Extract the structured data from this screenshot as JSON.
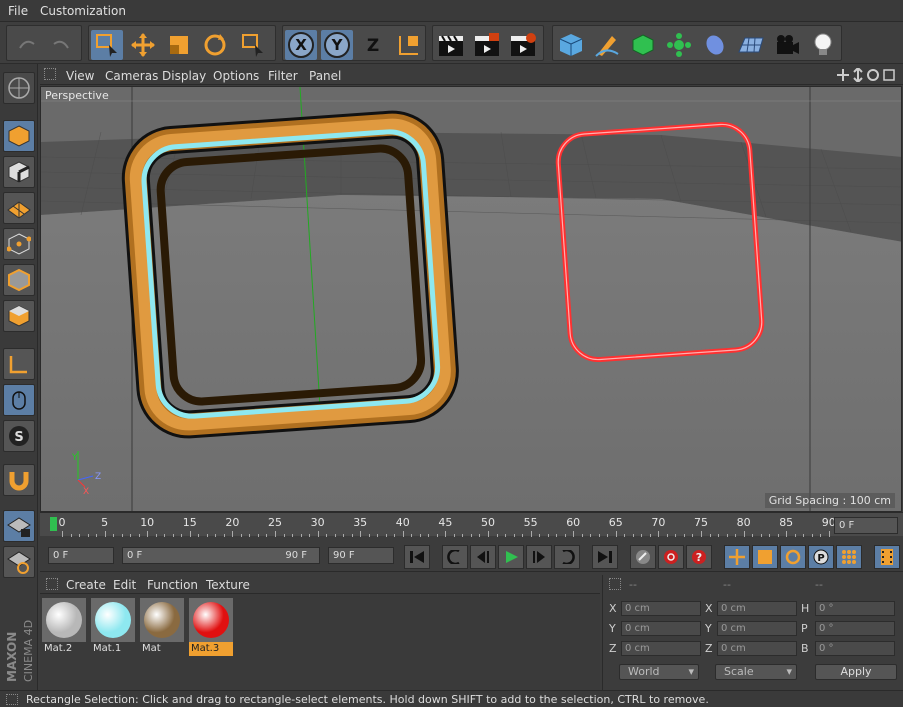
{
  "menubar": {
    "items": [
      "File",
      "Customization"
    ]
  },
  "toolbar": {
    "axis_x": "X",
    "axis_y": "Y",
    "axis_z": "Z"
  },
  "viewport": {
    "menu": [
      "View",
      "Cameras",
      "Display",
      "Options",
      "Filter",
      "Panel"
    ],
    "label": "Perspective",
    "grid_spacing": "Grid Spacing : 100 cm"
  },
  "timeline": {
    "ticks": [
      "0",
      "5",
      "10",
      "15",
      "20",
      "25",
      "30",
      "35",
      "40",
      "45",
      "50",
      "55",
      "60",
      "65",
      "70",
      "75",
      "80",
      "85",
      "90"
    ],
    "current_frame": "0 F"
  },
  "playback": {
    "start": "0 F",
    "range_start": "0 F",
    "range_end": "90 F",
    "end": "90 F"
  },
  "materials": {
    "menu": [
      "Create",
      "Edit",
      "Function",
      "Texture"
    ],
    "items": [
      {
        "name": "Mat.2",
        "color": "#b8b8b8"
      },
      {
        "name": "Mat.1",
        "color": "#8ee8f0"
      },
      {
        "name": "Mat",
        "color": "#8a6a40"
      },
      {
        "name": "Mat.3",
        "color": "#e01010"
      }
    ],
    "selected": "Mat.3"
  },
  "coords": {
    "headers": [
      "--",
      "--",
      "--"
    ],
    "pos": [
      {
        "label": "X",
        "value": "0 cm"
      },
      {
        "label": "Y",
        "value": "0 cm"
      },
      {
        "label": "Z",
        "value": "0 cm"
      }
    ],
    "size": [
      {
        "label": "X",
        "value": "0 cm"
      },
      {
        "label": "Y",
        "value": "0 cm"
      },
      {
        "label": "Z",
        "value": "0 cm"
      }
    ],
    "rot": [
      {
        "label": "H",
        "value": "0 °"
      },
      {
        "label": "P",
        "value": "0 °"
      },
      {
        "label": "B",
        "value": "0 °"
      }
    ],
    "mode_world": "World",
    "mode_scale": "Scale",
    "apply": "Apply"
  },
  "status": {
    "text": "Rectangle Selection: Click and drag to rectangle-select elements. Hold down SHIFT to add to the selection, CTRL to remove."
  },
  "branding": {
    "line1": "MAXON",
    "line2": "CINEMA 4D"
  },
  "colors": {
    "accent_blue": "#5c7ea5",
    "orange": "#f0a030",
    "red_frame": "#e01010",
    "cyan_frame": "#8ee8f0"
  }
}
